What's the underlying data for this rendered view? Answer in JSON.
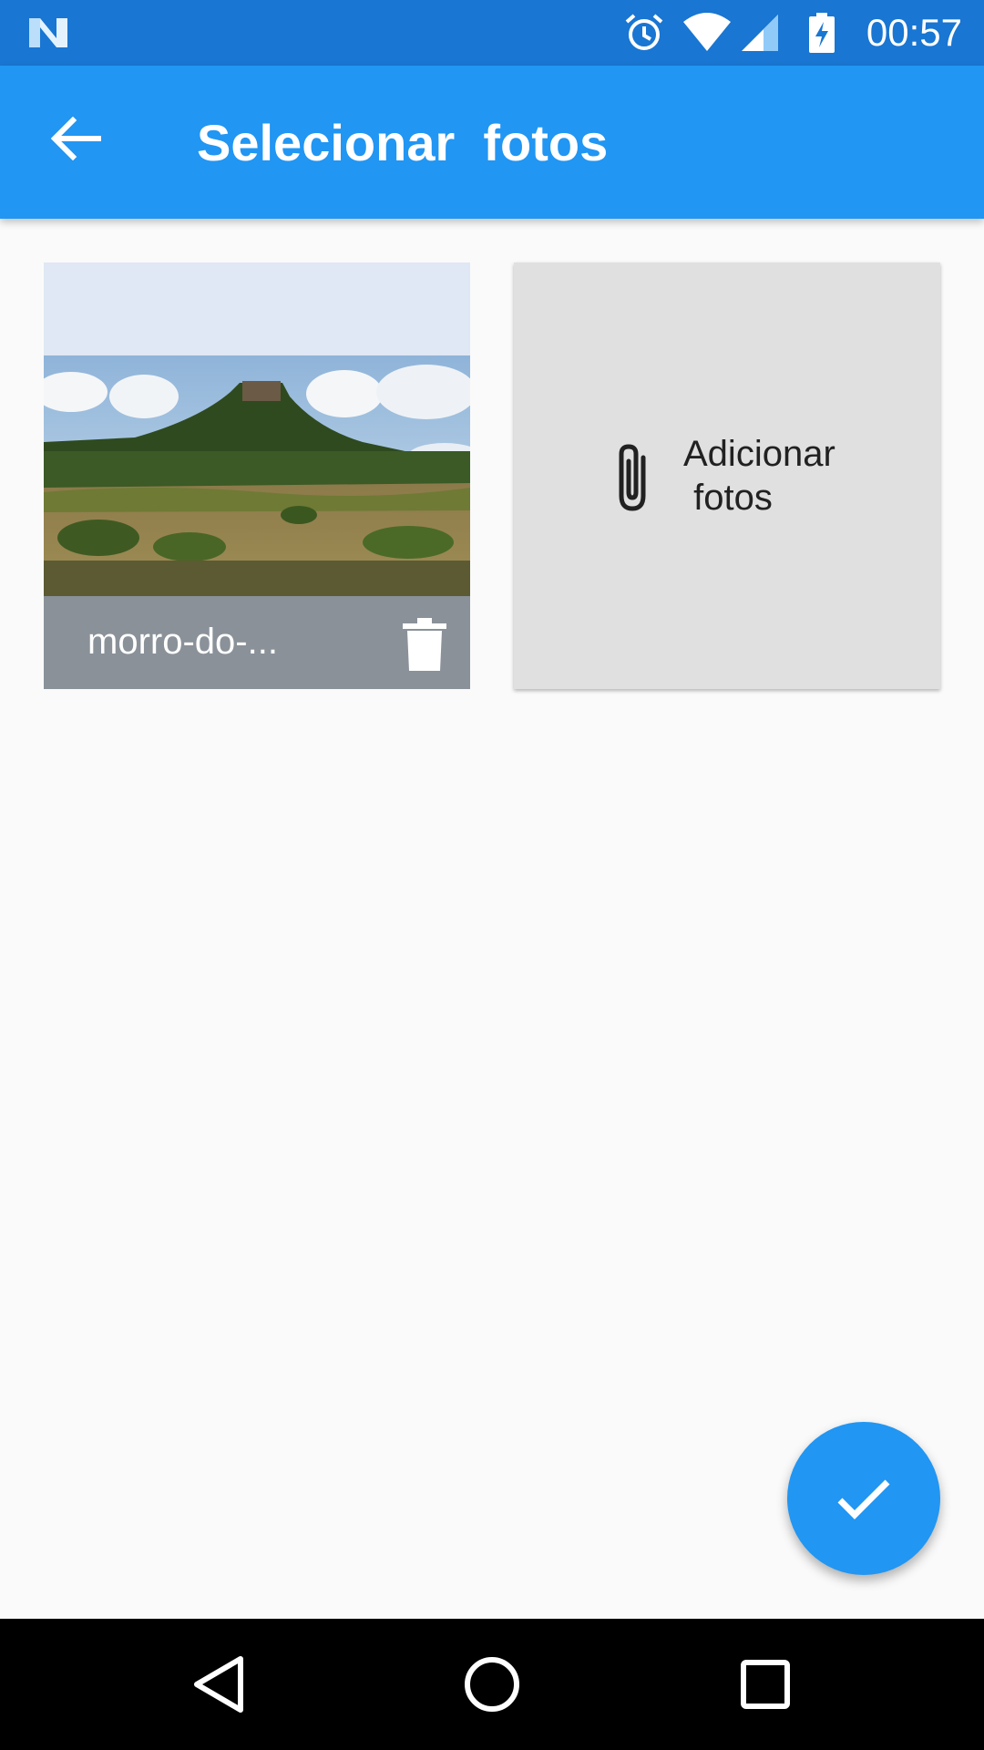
{
  "status_bar": {
    "time": "00:57",
    "icons": [
      "n-logo-icon",
      "alarm-icon",
      "wifi-icon",
      "signal-icon",
      "battery-charging-icon"
    ],
    "color": "#1976d2"
  },
  "app_bar": {
    "title": "Selecionar  fotos",
    "back_icon": "arrow-back-icon",
    "color": "#2196f3"
  },
  "photos": [
    {
      "name": "morro-do-...",
      "delete_icon": "trash-icon"
    }
  ],
  "add_tile": {
    "label": "Adicionar\n fotos",
    "icon": "paperclip-icon"
  },
  "fab": {
    "icon": "check-icon",
    "color": "#2196f3"
  },
  "nav_bar": {
    "icons": [
      "back-triangle-icon",
      "home-circle-icon",
      "recents-square-icon"
    ]
  }
}
